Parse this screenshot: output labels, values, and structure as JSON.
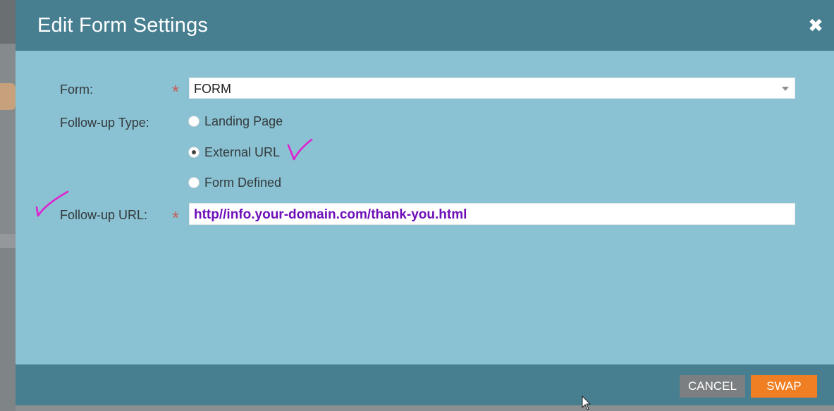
{
  "dialog": {
    "title": "Edit Form Settings",
    "close_glyph": "✖"
  },
  "form_field": {
    "label": "Form:",
    "required_mark": "*",
    "value": "FORM"
  },
  "follow_up_type": {
    "label": "Follow-up Type:",
    "options": [
      {
        "label": "Landing Page",
        "checked": false
      },
      {
        "label": "External URL",
        "checked": true
      },
      {
        "label": "Form Defined",
        "checked": false
      }
    ]
  },
  "follow_up_url": {
    "label": "Follow-up URL:",
    "required_mark": "*",
    "value": "http//info.your-domain.com/thank-you.html"
  },
  "footer": {
    "cancel_label": "CANCEL",
    "swap_label": "SWAP"
  },
  "colors": {
    "header_bg": "#477f91",
    "body_bg": "#8ac2d3",
    "swap_button": "#f07f23",
    "cancel_button": "#7b7f82",
    "url_text": "#6e0fb8",
    "annotation_ink": "#e020d0"
  },
  "icons": {
    "close": "close-icon",
    "dropdown": "chevron-down-icon",
    "cursor": "mouse-pointer-icon"
  }
}
